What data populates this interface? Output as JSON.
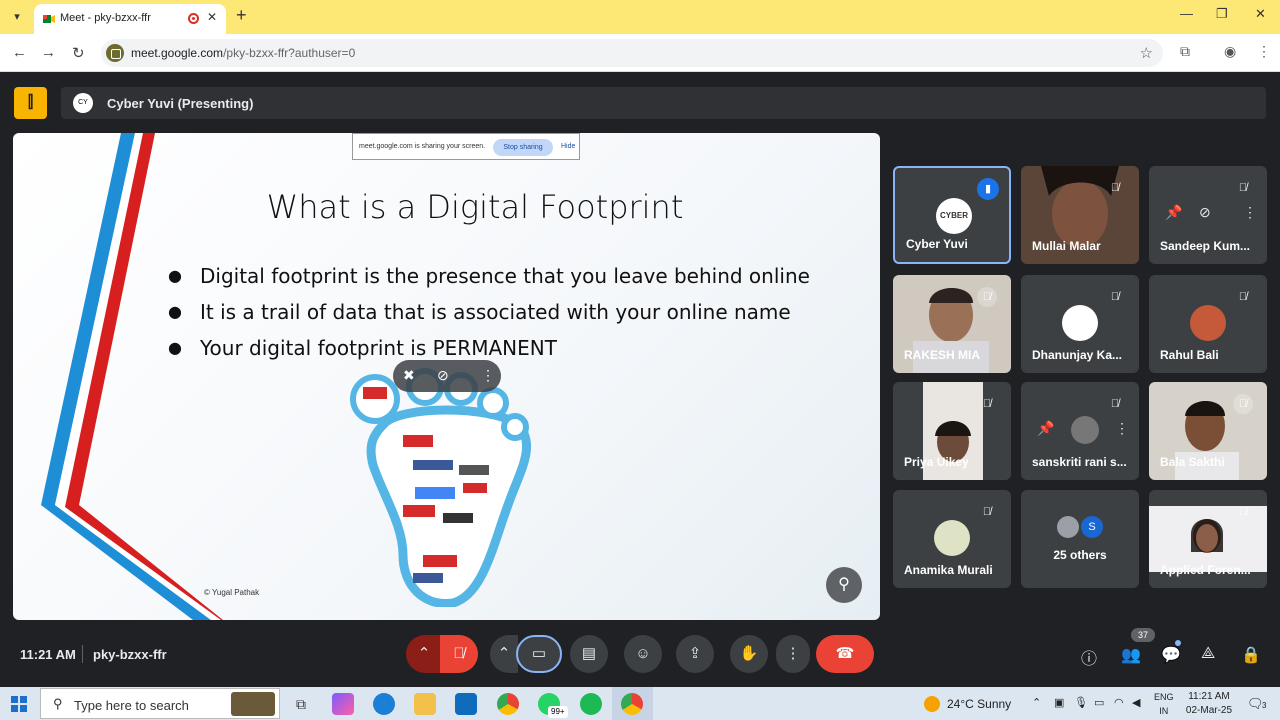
{
  "browser": {
    "tab_title": "Meet - pky-bzxx-ffr",
    "url_host": "meet.google.com",
    "url_path": "/pky-bzxx-ffr?authuser=0"
  },
  "meet": {
    "presenting_label": "Cyber Yuvi (Presenting)",
    "time": "11:21 AM",
    "meeting_code": "pky-bzxx-ffr",
    "people_count": "37"
  },
  "slide": {
    "share_banner_text": "meet.google.com is sharing your screen.",
    "stop_sharing": "Stop sharing",
    "hide": "Hide",
    "title": "What is a Digital Footprint",
    "bullets": [
      "Digital footprint is the presence that you leave behind online",
      "It is a trail of data that is associated with your online name",
      "Your digital footprint is PERMANENT"
    ],
    "copyright": "© Yugal Pathak"
  },
  "participants": [
    {
      "name": "Cyber Yuvi",
      "avatar": "CYBER"
    },
    {
      "name": "Mullai Malar"
    },
    {
      "name": "Sandeep Kum..."
    },
    {
      "name": "RAKESH MIA"
    },
    {
      "name": "Dhanunjay Ka..."
    },
    {
      "name": "Rahul Bali"
    },
    {
      "name": "Priya Uikey"
    },
    {
      "name": "sanskriti rani s..."
    },
    {
      "name": "Bala Sakthi"
    },
    {
      "name": "Anamika Murali"
    },
    {
      "name": "Applied Foren..."
    }
  ],
  "others": {
    "label": "25 others",
    "initial": "S"
  },
  "taskbar": {
    "search_placeholder": "Type here to search",
    "badge": "99+",
    "weather": "24°C  Sunny",
    "lang_line1": "ENG",
    "lang_line2": "IN",
    "clock_time": "11:21 AM",
    "clock_date": "02-Mar-25",
    "notif_count": "3"
  }
}
